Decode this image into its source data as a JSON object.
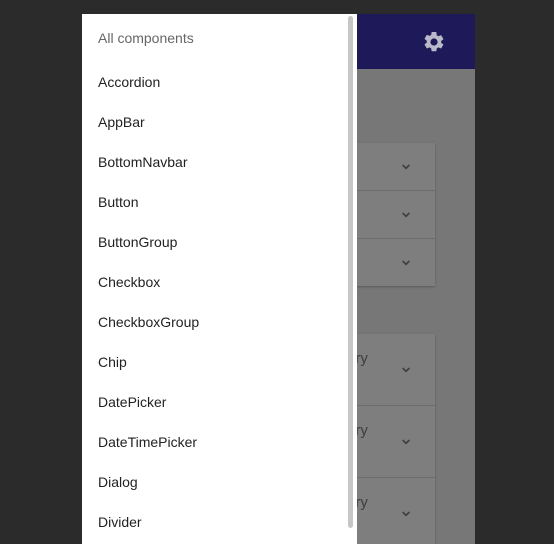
{
  "drawer": {
    "header": "All components",
    "items": [
      "Accordion",
      "AppBar",
      "BottomNavbar",
      "Button",
      "ButtonGroup",
      "Checkbox",
      "CheckboxGroup",
      "Chip",
      "DatePicker",
      "DateTimePicker",
      "Dialog",
      "Divider"
    ]
  },
  "background": {
    "partial_label": "ary",
    "icons": {
      "settings": "gear-icon",
      "expand": "chevron-down-icon"
    }
  },
  "colors": {
    "appbar": "#1e1a5a",
    "scrim": "#777777",
    "drawer": "#ffffff"
  }
}
